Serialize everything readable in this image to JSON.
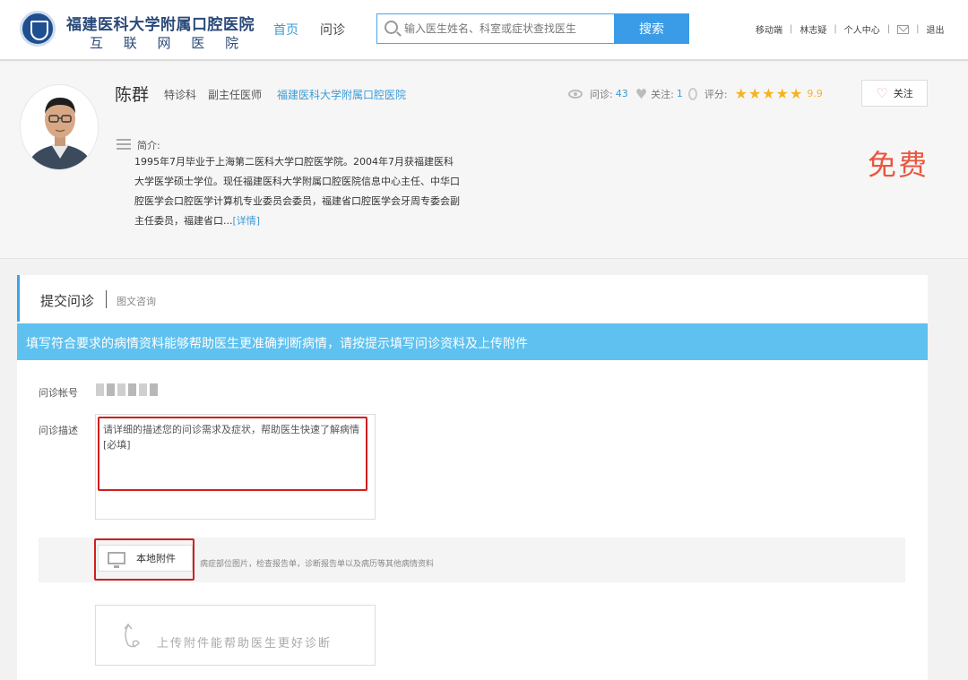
{
  "header": {
    "logo_title": "福建医科大学附属口腔医院",
    "logo_subtitle": "互 联 网 医 院",
    "nav_home": "首页",
    "nav_consult": "问诊",
    "search_placeholder": "输入医生姓名、科室或症状查找医生",
    "search_button": "搜索",
    "links": {
      "mobile": "移动端",
      "user": "林志疑",
      "personal": "个人中心",
      "logout": "退出"
    }
  },
  "doctor": {
    "name": "陈群",
    "department": "特诊科",
    "title": "副主任医师",
    "hospital": "福建医科大学附属口腔医院",
    "consult_label": "问诊:",
    "consult_count": "43",
    "follow_label": "关注:",
    "follow_count": "1",
    "rating_label": "评分:",
    "stars": "★★★★★",
    "rating": "9.9",
    "follow_button": "关注",
    "intro_label": "简介:",
    "intro_text": "1995年7月毕业于上海第二医科大学口腔医学院。2004年7月获福建医科大学医学硕士学位。现任福建医科大学附属口腔医院信息中心主任、中华口腔医学会口腔医学计算机专业委员会委员，福建省口腔医学会牙周专委会副主任委员，福建省口...",
    "intro_more": "[详情]",
    "price": "免费"
  },
  "form": {
    "title": "提交问诊",
    "subtitle": "图文咨询",
    "banner": "填写符合要求的病情资料能够帮助医生更准确判断病情，请按提示填写问诊资料及上传附件",
    "account_label": "问诊帐号",
    "desc_label": "问诊描述",
    "desc_placeholder": "请详细的描述您的问诊需求及症状，帮助医生快速了解病情 [必填]",
    "attach_button": "本地附件",
    "attach_hint": "病症部位图片，检查报告单，诊断报告单以及病历等其他病情资料",
    "upload_hint": "上传附件能帮助医生更好诊断"
  },
  "colors": {
    "accent": "#3a9ce6",
    "banner": "#5ec1ef",
    "price": "#e9563f",
    "highlight": "#d11f1f",
    "stars": "#f5b324"
  }
}
